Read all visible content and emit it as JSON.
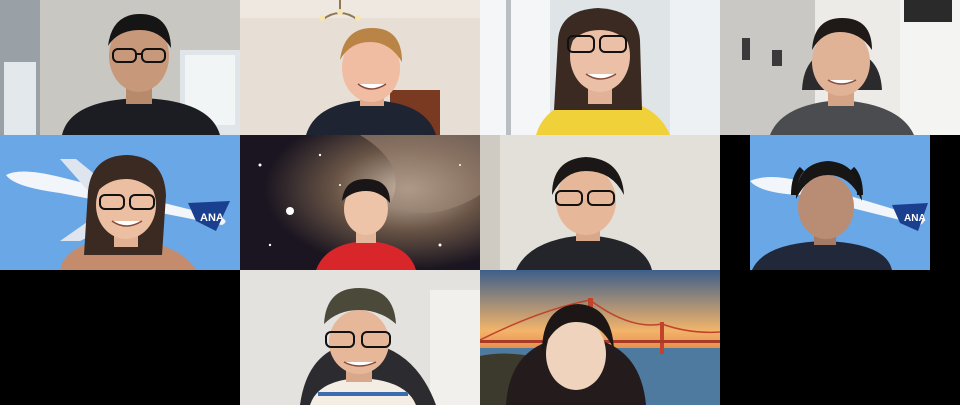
{
  "gallery": {
    "participants": [
      {
        "position": 1,
        "background": "room"
      },
      {
        "position": 2,
        "background": "room"
      },
      {
        "position": 3,
        "background": "room"
      },
      {
        "position": 4,
        "background": "room"
      },
      {
        "position": 5,
        "background": "virtual-airplane"
      },
      {
        "position": 6,
        "background": "virtual-nebula"
      },
      {
        "position": 7,
        "background": "room"
      },
      {
        "position": 8,
        "background": "virtual-airplane"
      },
      {
        "position": 9,
        "background": "room"
      },
      {
        "position": 10,
        "background": "virtual-golden-gate-bridge"
      }
    ],
    "airplane_logo": "ANA"
  },
  "colors": {
    "canvas": "#000000",
    "sky": "#6aa7e6",
    "tail_blue": "#1b3f8f"
  }
}
